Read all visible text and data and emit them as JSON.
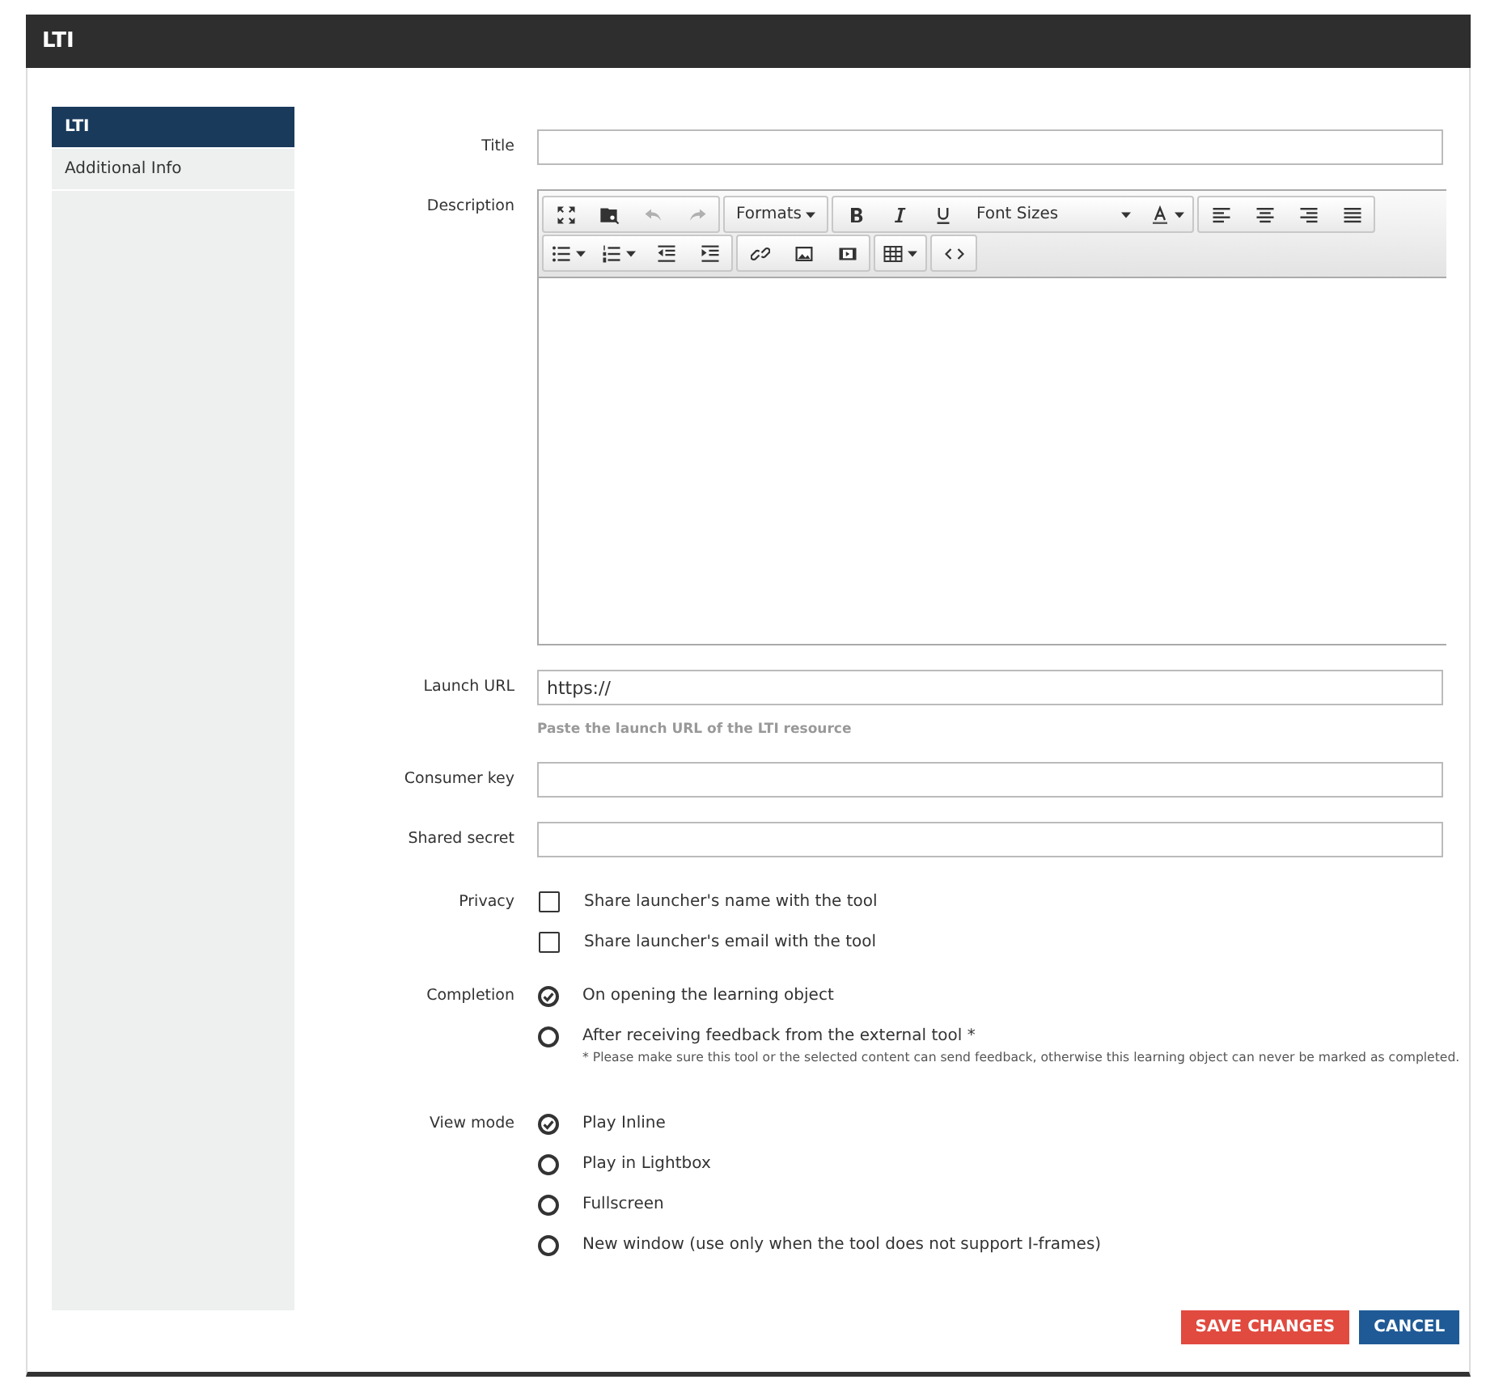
{
  "window": {
    "title": "LTI"
  },
  "sidebar": {
    "items": [
      {
        "label": "LTI",
        "selected": true
      },
      {
        "label": "Additional Info",
        "selected": false
      }
    ]
  },
  "form": {
    "title": {
      "label": "Title"
    },
    "description": {
      "label": "Description",
      "toolbar": [
        [
          {
            "kind": "fullscreen",
            "disabled": false
          },
          {
            "kind": "preview",
            "disabled": false
          },
          {
            "kind": "undo",
            "disabled": true
          },
          {
            "kind": "redo",
            "disabled": true
          }
        ],
        [
          {
            "kind": "menu",
            "label": "Formats",
            "dropdown": true
          }
        ],
        [
          {
            "kind": "bold",
            "disabled": false
          },
          {
            "kind": "italic",
            "disabled": false
          },
          {
            "kind": "underline",
            "disabled": false
          },
          {
            "kind": "menu",
            "label": "Font Sizes",
            "dropdown": true
          },
          {
            "kind": "textcolor",
            "dropdown": true
          }
        ],
        [
          {
            "kind": "align-left",
            "disabled": false
          },
          {
            "kind": "align-center",
            "disabled": false
          },
          {
            "kind": "align-right",
            "disabled": false
          },
          {
            "kind": "justify",
            "disabled": false
          }
        ],
        [
          {
            "kind": "bullets",
            "dropdown": true
          },
          {
            "kind": "numbers",
            "dropdown": true
          },
          {
            "kind": "outdent",
            "disabled": false
          },
          {
            "kind": "indent",
            "disabled": false
          }
        ],
        [
          {
            "kind": "link",
            "disabled": false
          },
          {
            "kind": "image",
            "disabled": false
          },
          {
            "kind": "media",
            "disabled": false
          }
        ],
        [
          {
            "kind": "table",
            "dropdown": true
          }
        ],
        [
          {
            "kind": "code",
            "disabled": false
          }
        ]
      ]
    },
    "launch_url": {
      "label": "Launch URL",
      "value": "https://",
      "help": "Paste the launch URL of the LTI resource"
    },
    "consumer_key": {
      "label": "Consumer key"
    },
    "shared_secret": {
      "label": "Shared secret"
    },
    "privacy": {
      "label": "Privacy",
      "options": [
        {
          "label": "Share launcher's name with the tool",
          "checked": false
        },
        {
          "label": "Share launcher's email with the tool",
          "checked": false
        }
      ]
    },
    "completion": {
      "label": "Completion",
      "options": [
        {
          "label": "On opening the learning object",
          "selected": true
        },
        {
          "label": "After receiving feedback from the external tool *",
          "selected": false
        }
      ],
      "note": "* Please make sure this tool or the selected content can send feedback, otherwise this learning object can never be marked as completed."
    },
    "view_mode": {
      "label": "View mode",
      "options": [
        {
          "label": "Play Inline",
          "selected": true
        },
        {
          "label": "Play in Lightbox",
          "selected": false
        },
        {
          "label": "Fullscreen",
          "selected": false
        },
        {
          "label": "New window (use only when the tool does not support I-frames)",
          "selected": false
        }
      ]
    }
  },
  "buttons": [
    {
      "label": "SAVE CHANGES",
      "kind": "primary"
    },
    {
      "label": "CANCEL",
      "kind": "secondary"
    }
  ]
}
